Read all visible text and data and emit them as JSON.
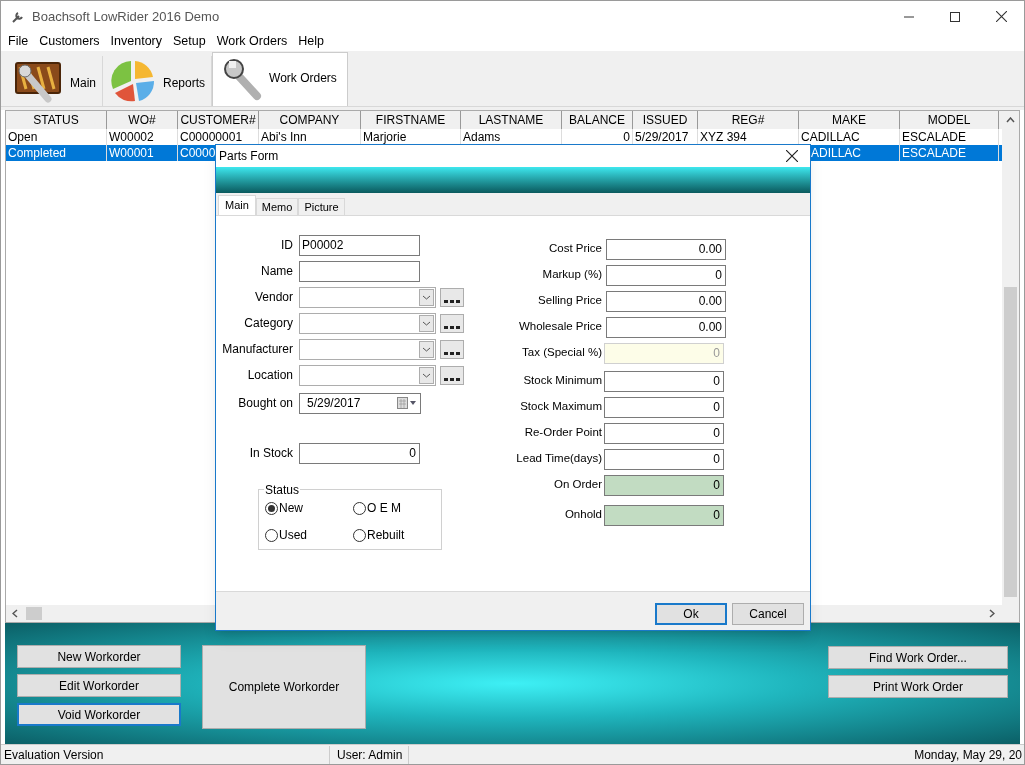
{
  "window": {
    "title": "Boachsoft LowRider 2016 Demo"
  },
  "menu": [
    "File",
    "Customers",
    "Inventory",
    "Setup",
    "Work Orders",
    "Help"
  ],
  "toolbar_tabs": [
    {
      "kind": "main",
      "label": "Main",
      "selected": false
    },
    {
      "kind": "reports",
      "label": "Reports",
      "selected": false
    },
    {
      "kind": "workorders",
      "label": "Work Orders",
      "selected": true
    }
  ],
  "table": {
    "columns": [
      "STATUS",
      "WO#",
      "CUSTOMER#",
      "COMPANY",
      "FIRSTNAME",
      "LASTNAME",
      "BALANCE",
      "ISSUED",
      "REG#",
      "MAKE",
      "MODEL"
    ],
    "rows": [
      {
        "selected": false,
        "cells": [
          "Open",
          "W00002",
          "C00000001",
          "Abi's Inn",
          "Marjorie",
          "Adams",
          "0",
          "5/29/2017",
          "XYZ 394",
          "CADILLAC",
          "ESCALADE"
        ]
      },
      {
        "selected": true,
        "cells": [
          "Completed",
          "W00001",
          "C0000",
          null,
          null,
          null,
          null,
          null,
          null,
          "ADILLAC",
          "ESCALADE"
        ]
      }
    ]
  },
  "dialog": {
    "title": "Parts Form",
    "tabs": [
      {
        "label": "Main",
        "selected": true
      },
      {
        "label": "Memo",
        "selected": false
      },
      {
        "label": "Picture",
        "selected": false
      }
    ],
    "left_fields": [
      {
        "kind": "text",
        "label": "ID",
        "value": "P00002"
      },
      {
        "kind": "text",
        "label": "Name"
      },
      {
        "kind": "combo",
        "label": "Vendor"
      },
      {
        "kind": "combo",
        "label": "Category"
      },
      {
        "kind": "combo",
        "label": "Manufacturer"
      },
      {
        "kind": "combo",
        "label": "Location"
      },
      {
        "kind": "date",
        "label": "Bought on",
        "value": "5/29/2017"
      },
      {
        "kind": "number",
        "label": "In Stock",
        "value": "0"
      }
    ],
    "status_group": {
      "title": "Status",
      "options": [
        {
          "label": "New",
          "selected": true
        },
        {
          "label": "O E M",
          "selected": false
        },
        {
          "label": "Used",
          "selected": false
        },
        {
          "label": "Rebuilt",
          "selected": false
        }
      ]
    },
    "right_fields": [
      {
        "kind": "text",
        "label": "Cost Price",
        "value": "0.00"
      },
      {
        "kind": "text",
        "label": "Markup (%)",
        "value": "0"
      },
      {
        "kind": "text",
        "label": "Selling Price",
        "value": "0.00"
      },
      {
        "kind": "text",
        "label": "Wholesale Price",
        "value": "0.00"
      },
      {
        "kind": "disabled",
        "label": "Tax (Special %)",
        "value": "0"
      },
      {
        "kind": "text",
        "label": "Stock Minimum",
        "value": "0"
      },
      {
        "kind": "text",
        "label": "Stock Maximum",
        "value": "0"
      },
      {
        "kind": "text",
        "label": "Re-Order Point",
        "value": "0"
      },
      {
        "kind": "text",
        "label": "Lead Time(days)",
        "value": "0"
      },
      {
        "kind": "computed",
        "label": "On Order",
        "value": "0"
      },
      {
        "kind": "computed",
        "label": "Onhold",
        "value": "0"
      }
    ],
    "buttons": [
      {
        "label": "Ok",
        "focused": true
      },
      {
        "label": "Cancel",
        "focused": false
      }
    ]
  },
  "actions_left": [
    {
      "label": "New Workorder",
      "focused": false
    },
    {
      "label": "Edit Workorder",
      "focused": false
    },
    {
      "label": "Void Workorder",
      "focused": true
    }
  ],
  "action_center": {
    "label": "Complete Workorder"
  },
  "actions_right": [
    {
      "label": "Find Work Order...",
      "focused": false
    },
    {
      "label": "Print Work Order",
      "focused": false
    }
  ],
  "status_bar": [
    "Evaluation Version",
    "User: Admin",
    "Monday, May 29, 20"
  ]
}
